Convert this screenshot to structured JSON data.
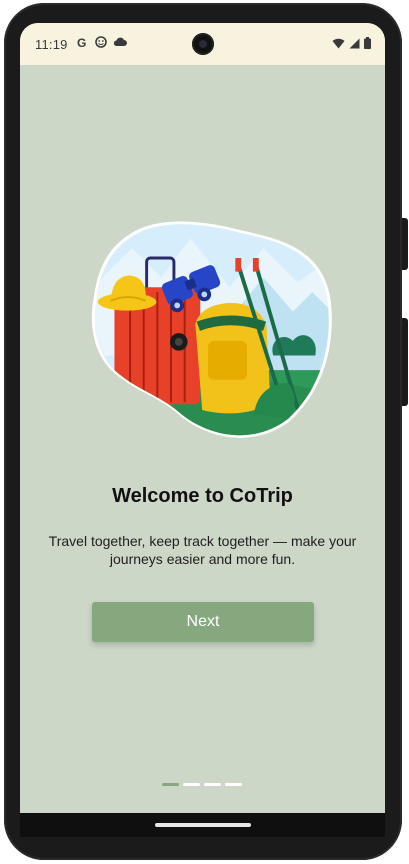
{
  "status_bar": {
    "time": "11:19",
    "left_icons": [
      "google-icon",
      "face-icon",
      "cloud-icon"
    ],
    "right_icons": [
      "wifi-icon",
      "signal-icon",
      "battery-icon"
    ]
  },
  "onboarding": {
    "title": "Welcome to CoTrip",
    "subtitle": "Travel together, keep track together — make your journeys easier and more fun.",
    "next_label": "Next",
    "page_indicator": {
      "total": 4,
      "current": 1
    }
  },
  "colors": {
    "background": "#ccd7c8",
    "status_bar": "#f8f3df",
    "accent": "#86a87f"
  }
}
